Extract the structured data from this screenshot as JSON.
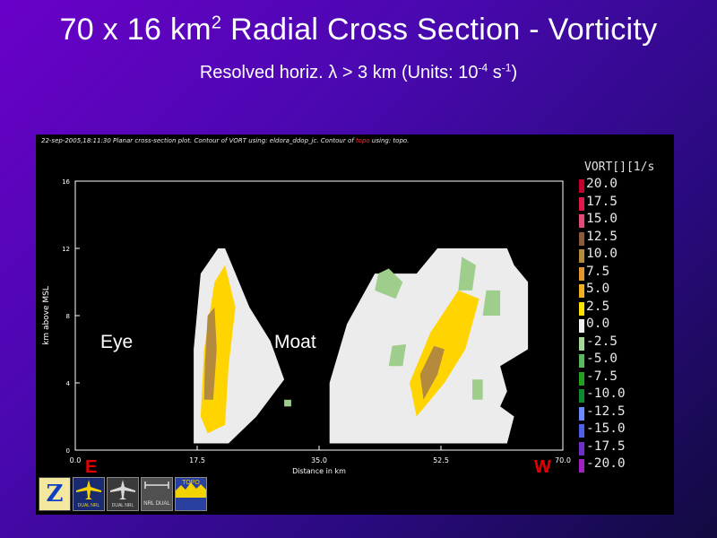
{
  "slide": {
    "title_main": "70 x 16 km",
    "title_sup": "2",
    "title_rest": " Radial Cross Section - Vorticity",
    "subtitle_pre": "Resolved horiz. ",
    "subtitle_lambda": "λ",
    "subtitle_mid": " > 3 km (Units: 10",
    "subtitle_sup1": "-4",
    "subtitle_mid2": " s",
    "subtitle_sup2": "-1",
    "subtitle_end": ")"
  },
  "plot_header": {
    "text_a": "22-sep-2005,18:11:30  Planar cross-section plot.  Contour of VORT using: eldora_ddop_jc.  Contour of ",
    "text_topo": "topo",
    "text_b": " using: topo."
  },
  "annotations": {
    "eye": "Eye",
    "moat": "Moat",
    "east": "E",
    "west": "W"
  },
  "logos": {
    "z_icon": "Z",
    "dual_nrl_1": "DUAL NRL",
    "dual_nrl_2": "DUAL NRL",
    "nrl_dual": "NRL DUAL",
    "topo": "TOPO"
  },
  "colors": {
    "white_zero": "#ececec",
    "yellow": "#ffd400",
    "orange": "#f2a825",
    "brown": "#b48a3c",
    "light_green": "#9fce8c"
  },
  "chart_data": {
    "type": "heatmap",
    "title": "70 x 16 km2 Radial Cross Section - Vorticity",
    "xlabel": "Distance in km",
    "ylabel": "km above MSL",
    "xlim": [
      0,
      70
    ],
    "ylim": [
      0,
      16
    ],
    "x_ticks": [
      0.0,
      17.5,
      35.0,
      52.5,
      70.0
    ],
    "x_tick_labels": [
      "0.0",
      "17.5",
      "35.0",
      "52.5",
      "70.0"
    ],
    "y_ticks": [
      0,
      4,
      8,
      12,
      16
    ],
    "y_tick_labels": [
      "0",
      "4",
      "8",
      "12",
      "16"
    ],
    "legend_title": "VORT[][1/s",
    "legend": [
      {
        "value": "20.0",
        "color": "#c4002c"
      },
      {
        "value": "17.5",
        "color": "#e2184a"
      },
      {
        "value": "15.0",
        "color": "#e24a78"
      },
      {
        "value": "12.5",
        "color": "#8c5c38"
      },
      {
        "value": "10.0",
        "color": "#b48a3c"
      },
      {
        "value": "7.5",
        "color": "#e0962a"
      },
      {
        "value": "5.0",
        "color": "#f0b020"
      },
      {
        "value": "2.5",
        "color": "#ffe000"
      },
      {
        "value": "0.0",
        "color": "#f0f0f0"
      },
      {
        "value": "-2.5",
        "color": "#a8d898"
      },
      {
        "value": "-5.0",
        "color": "#5cb85c"
      },
      {
        "value": "-7.5",
        "color": "#22a022"
      },
      {
        "value": "-10.0",
        "color": "#108c30"
      },
      {
        "value": "-12.5",
        "color": "#6a8cff"
      },
      {
        "value": "-15.0",
        "color": "#5060e8"
      },
      {
        "value": "-17.5",
        "color": "#7030c8"
      },
      {
        "value": "-20.0",
        "color": "#a020c0"
      }
    ],
    "regions": {
      "eyewall_outline": [
        [
          17.0,
          0.4
        ],
        [
          22.0,
          0.4
        ],
        [
          26.0,
          2.0
        ],
        [
          30.0,
          4.2
        ],
        [
          28.0,
          6.5
        ],
        [
          25.0,
          8.5
        ],
        [
          22.5,
          11.0
        ],
        [
          21.5,
          12.0
        ],
        [
          20.5,
          12.0
        ],
        [
          18.0,
          10.5
        ],
        [
          17.0,
          6.0
        ]
      ],
      "outer_outline": [
        [
          36.5,
          0.4
        ],
        [
          62.0,
          0.4
        ],
        [
          63.0,
          2.0
        ],
        [
          61.0,
          2.6
        ],
        [
          62.0,
          3.5
        ],
        [
          61.0,
          5.0
        ],
        [
          65.0,
          6.0
        ],
        [
          65.0,
          8.0
        ],
        [
          65.0,
          10.0
        ],
        [
          63.0,
          11.0
        ],
        [
          62.0,
          12.0
        ],
        [
          52.0,
          12.0
        ],
        [
          49.0,
          10.5
        ],
        [
          43.0,
          10.5
        ],
        [
          39.0,
          7.5
        ],
        [
          36.5,
          4.0
        ]
      ],
      "positive_cores": [
        [
          [
            18.0,
            2.0
          ],
          [
            19.0,
            1.0
          ],
          [
            21.5,
            1.5
          ],
          [
            22.0,
            5.0
          ],
          [
            23.0,
            8.5
          ],
          [
            21.5,
            11.0
          ],
          [
            20.0,
            10.0
          ],
          [
            18.5,
            6.0
          ]
        ],
        [
          [
            49.0,
            2.0
          ],
          [
            53.0,
            4.0
          ],
          [
            56.0,
            6.0
          ],
          [
            58.0,
            9.0
          ],
          [
            55.0,
            9.5
          ],
          [
            51.0,
            7.0
          ],
          [
            48.0,
            4.0
          ]
        ]
      ],
      "strong_cores": [
        [
          [
            18.5,
            3.0
          ],
          [
            19.8,
            3.0
          ],
          [
            20.3,
            6.0
          ],
          [
            20.0,
            8.5
          ],
          [
            19.0,
            8.0
          ],
          [
            18.6,
            5.0
          ]
        ],
        [
          [
            50.0,
            3.0
          ],
          [
            52.0,
            4.5
          ],
          [
            53.0,
            6.0
          ],
          [
            51.5,
            6.2
          ],
          [
            49.5,
            4.5
          ]
        ]
      ],
      "negative_patches": [
        [
          [
            43.0,
            9.5
          ],
          [
            46.0,
            9.0
          ],
          [
            47.0,
            10.0
          ],
          [
            45.0,
            10.8
          ],
          [
            43.5,
            10.5
          ]
        ],
        [
          [
            55.0,
            9.5
          ],
          [
            57.0,
            9.5
          ],
          [
            57.5,
            11.0
          ],
          [
            55.5,
            11.5
          ]
        ],
        [
          [
            58.5,
            8.0
          ],
          [
            61.0,
            8.0
          ],
          [
            61.0,
            9.5
          ],
          [
            59.0,
            9.5
          ]
        ],
        [
          [
            45.0,
            5.0
          ],
          [
            47.0,
            5.0
          ],
          [
            47.5,
            6.3
          ],
          [
            45.5,
            6.2
          ]
        ],
        [
          [
            57.0,
            3.0
          ],
          [
            58.5,
            3.0
          ],
          [
            58.5,
            4.2
          ],
          [
            57.0,
            4.2
          ]
        ],
        [
          [
            30.0,
            2.6
          ],
          [
            31.0,
            2.6
          ],
          [
            31.0,
            3.0
          ],
          [
            30.0,
            3.0
          ]
        ]
      ]
    }
  }
}
